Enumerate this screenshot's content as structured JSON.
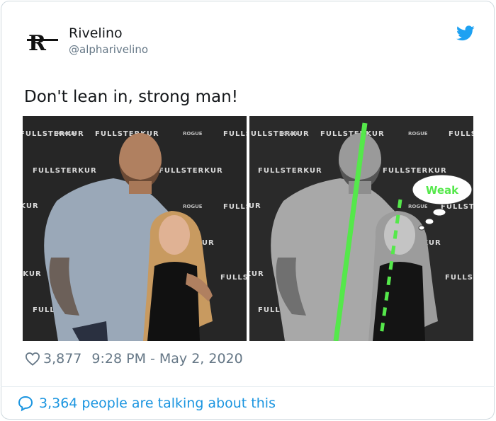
{
  "author": {
    "name": "Rivelino",
    "handle": "@alpharivelino",
    "avatar_letter": "R"
  },
  "tweet": {
    "text": "Don't lean in, strong man!"
  },
  "media": {
    "banner_brand": "FULLSTERKUR",
    "banner_sponsor": "ROGUE",
    "annotation_label": "Weak",
    "line_color": "#55e84b"
  },
  "meta": {
    "likes": "3,877",
    "timestamp": "9:28 PM - May 2, 2020"
  },
  "footer": {
    "talking": "3,364 people are talking about this"
  },
  "colors": {
    "accent": "#1b95e0",
    "bird": "#1da1f2",
    "text": "#14171a",
    "muted": "#657786"
  }
}
